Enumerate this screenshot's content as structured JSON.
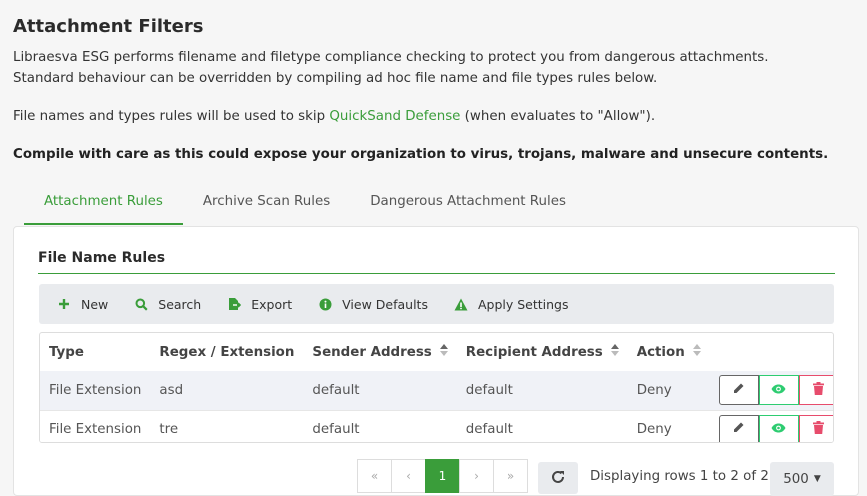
{
  "page": {
    "title": "Attachment Filters",
    "desc_line1": "Libraesva ESG performs filename and filetype compliance checking to protect you from dangerous attachments.",
    "desc_line2": "Standard behaviour can be overridden by compiling ad hoc file name and file types rules below.",
    "desc_line3_pre": "File names and types rules will be used to skip ",
    "desc_line3_link": "QuickSand Defense",
    "desc_line3_post": " (when evaluates to \"Allow\").",
    "warning": "Compile with care as this could expose your organization to virus, trojans, malware and unsecure contents."
  },
  "tabs": [
    {
      "label": "Attachment Rules",
      "active": true
    },
    {
      "label": "Archive Scan Rules",
      "active": false
    },
    {
      "label": "Dangerous Attachment Rules",
      "active": false
    }
  ],
  "section": {
    "title": "File Name Rules"
  },
  "toolbar": {
    "new_label": "New",
    "search_label": "Search",
    "export_label": "Export",
    "view_defaults_label": "View Defaults",
    "apply_settings_label": "Apply Settings"
  },
  "table": {
    "headers": [
      "Type",
      "Regex / Extension",
      "Sender Address",
      "Recipient Address",
      "Action"
    ],
    "rows": [
      [
        "File Extension",
        "asd",
        "default",
        "default",
        "Deny"
      ],
      [
        "File Extension",
        "tre",
        "default",
        "default",
        "Deny"
      ]
    ]
  },
  "pagination": {
    "first": "«",
    "prev": "‹",
    "current": "1",
    "next": "›",
    "last": "»",
    "display_text": "Displaying rows 1 to 2 of 2",
    "page_size": "500"
  },
  "colors": {
    "accent": "#3a9d3a",
    "view": "#2ecc71",
    "delete": "#e74c6c"
  }
}
